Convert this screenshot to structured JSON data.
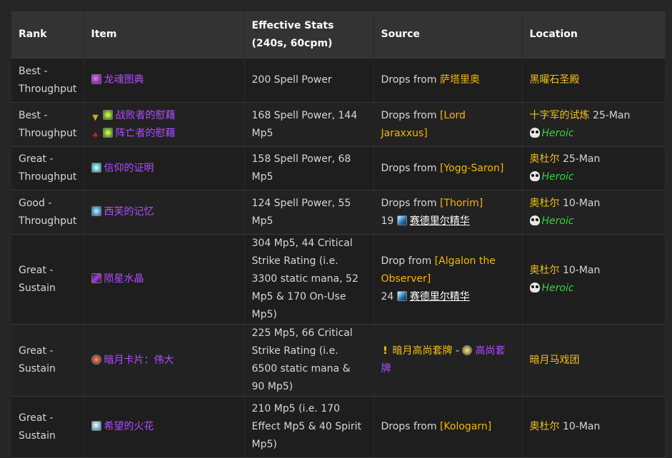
{
  "headers": {
    "rank": "Rank",
    "item": "Item",
    "stats": "Effective Stats (240s, 60cpm)",
    "source": "Source",
    "location": "Location"
  },
  "rows": [
    {
      "rank": "Best - Throughput",
      "item": "龙魂图典",
      "stats": "200 Spell Power",
      "source_prefix": "Drops from ",
      "source_link": "萨塔里奥",
      "location": "黑曜石圣殿"
    },
    {
      "rank": "Best - Throughput",
      "item_a": "战败者的慰藉",
      "item_b": "阵亡者的慰藉",
      "stats": "168 Spell Power, 144 Mp5",
      "source_prefix": "Drops from ",
      "source_link": "[Lord Jaraxxus]",
      "location": "十字军的试炼",
      "location_suffix": " 25-Man",
      "heroic": "Heroic"
    },
    {
      "rank": "Great - Throughput",
      "item": "信仰的证明",
      "stats": "158 Spell Power, 68 Mp5",
      "source_prefix": "Drops from ",
      "source_link": "[Yogg-Saron]",
      "location": "奥杜尔",
      "location_suffix": " 25-Man",
      "heroic": "Heroic"
    },
    {
      "rank": "Good - Throughput",
      "item": "西芙的记忆",
      "stats": "124 Spell Power, 55 Mp5",
      "source_prefix": "Drops from ",
      "source_link": "[Thorim]",
      "currency_count": "19",
      "currency_name": "赛德里尔精华",
      "location": "奥杜尔",
      "location_suffix": " 10-Man",
      "heroic": "Heroic"
    },
    {
      "rank": "Great - Sustain",
      "item": "陨星水晶",
      "stats": "304 Mp5, 44 Critical Strike Rating (i.e. 3300 static mana, 52 Mp5 & 170 On-Use Mp5)",
      "source_prefix": "Drop from ",
      "source_link": "[Algalon the Observer]",
      "currency_count": "24",
      "currency_name": "赛德里尔精华",
      "location": "奥杜尔",
      "location_suffix": " 10-Man",
      "heroic": "Heroic"
    },
    {
      "rank": "Great - Sustain",
      "item": "暗月卡片：伟大",
      "stats": "225 Mp5, 66 Critical Strike Rating (i.e. 6500 static mana & 90 Mp5)",
      "source_quest": "暗月高尚套牌",
      "source_sep": " - ",
      "source_item": "高尚套牌",
      "location": "暗月马戏团"
    },
    {
      "rank": "Great - Sustain",
      "item": "希望的火花",
      "stats": "210 Mp5 (i.e. 170 Effect Mp5 & 40 Spirit Mp5)",
      "source_prefix": "Drops from ",
      "source_link": "[Kologarn]",
      "location": "奥杜尔",
      "location_suffix": " 10-Man"
    }
  ],
  "icons": {
    "row1": "dragon-book-icon",
    "row2a": "alliance-emblem-icon",
    "row2b": "horde-emblem-icon",
    "row2_item": "green-trinket-icon",
    "row3": "cyan-rune-icon",
    "row4": "ice-rune-icon",
    "row5": "crystal-icon",
    "row6": "darkmoon-card-icon",
    "row7": "spark-icon",
    "heroic": "skull-icon",
    "quest": "quest-exclamation-icon",
    "currency": "essence-icon"
  },
  "colors": {
    "epic": "#b24cff",
    "location": "#f0c11b",
    "source_link": "#f5b800",
    "heroic": "#35d43a",
    "header_bg": "#333333",
    "row_bg": "#1e1e1e"
  }
}
